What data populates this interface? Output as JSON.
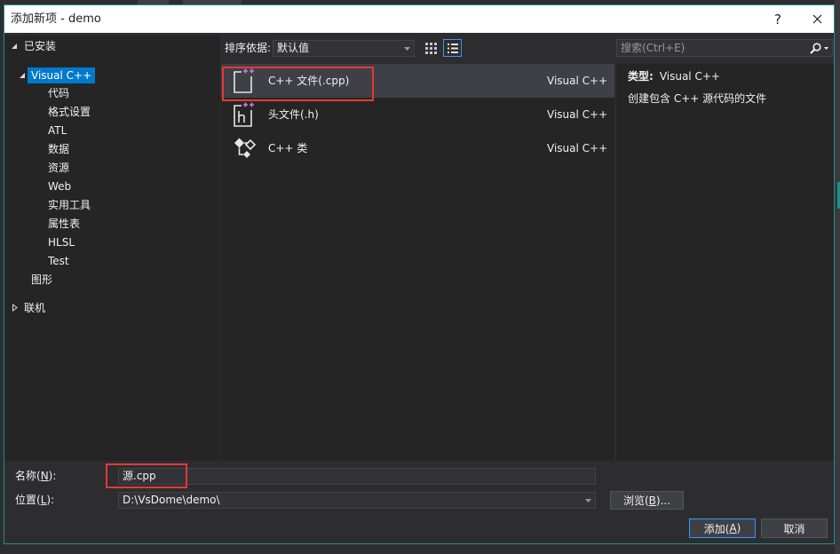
{
  "window": {
    "title": "添加新项 - demo",
    "help_label": "?",
    "close_icon": "close-icon"
  },
  "tree": {
    "installed": {
      "label": "已安装",
      "expanded": true
    },
    "visual_cpp": {
      "label": "Visual C++",
      "expanded": true,
      "selected": true
    },
    "children": [
      "代码",
      "格式设置",
      "ATL",
      "数据",
      "资源",
      "Web",
      "实用工具",
      "属性表",
      "HLSL",
      "Test"
    ],
    "graphics": {
      "label": "图形"
    },
    "online": {
      "label": "联机",
      "expanded": false
    }
  },
  "toolbar": {
    "sort_label": "排序依据:",
    "sort_value": "默认值",
    "grid_view_selected": false,
    "list_view_selected": true
  },
  "search": {
    "placeholder": "搜索(Ctrl+E)",
    "icon": "search-icon"
  },
  "templates": [
    {
      "name": "C++ 文件(.cpp)",
      "type": "Visual C++",
      "icon": "cpp-file-icon",
      "selected": true
    },
    {
      "name": "头文件(.h)",
      "type": "Visual C++",
      "icon": "header-file-icon",
      "selected": false
    },
    {
      "name": "C++ 类",
      "type": "Visual C++",
      "icon": "cpp-class-icon",
      "selected": false
    }
  ],
  "details": {
    "type_label": "类型:",
    "type_value": "Visual C++",
    "description": "创建包含 C++ 源代码的文件"
  },
  "form": {
    "name_label": "名称(N):",
    "name_value": "源.cpp",
    "location_label": "位置(L):",
    "location_value": "D:\\VsDome\\demo\\"
  },
  "buttons": {
    "browse": "浏览(B)...",
    "add": "添加(A)",
    "cancel": "取消"
  },
  "colors": {
    "accent": "#007acc",
    "focus_border": "#3399ff",
    "selection": "#3f3f46",
    "annotation": "#e53935",
    "frame": "#1f8f8a",
    "background": "#2d2d30",
    "panel": "#252526",
    "field": "#333337",
    "text": "#f1f1f1",
    "title_bar": "#ffffff"
  }
}
